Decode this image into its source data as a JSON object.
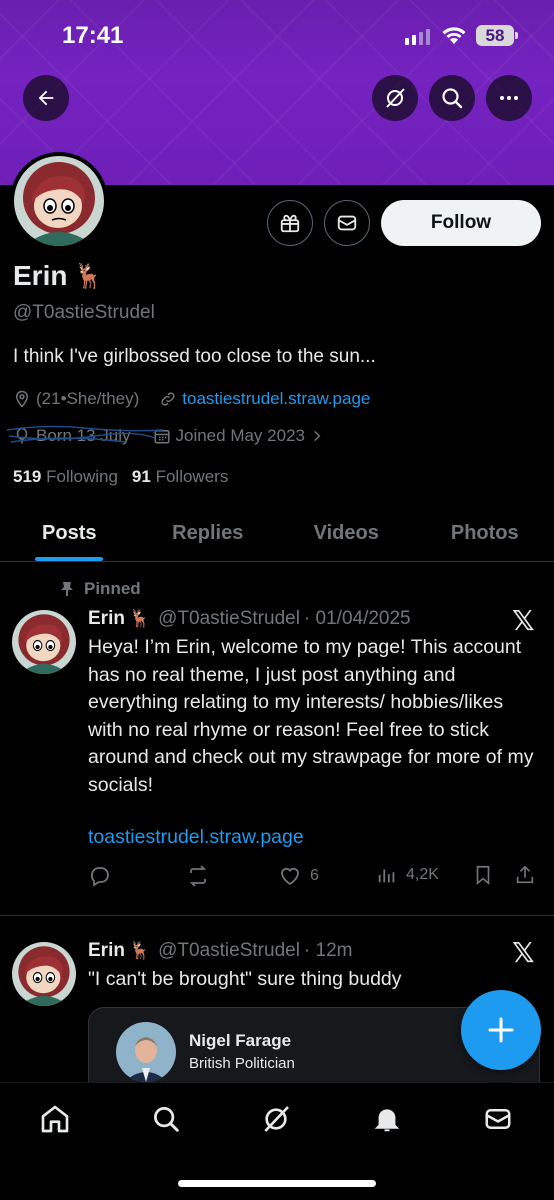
{
  "status_bar": {
    "time": "17:41",
    "battery": "58"
  },
  "profile": {
    "name": "Erin",
    "emoji": "🦌",
    "handle": "@T0astieStrudel",
    "follow_label": "Follow",
    "bio": "I think I've girlbossed too close to the sun...",
    "location": "(21•She/they)",
    "website": "toastiestrudel.straw.page",
    "born": "Born 13 July",
    "joined": "Joined May 2023",
    "following_count": "519",
    "following_label": "Following",
    "followers_count": "91",
    "followers_label": "Followers"
  },
  "tabs": [
    "Posts",
    "Replies",
    "Videos",
    "Photos"
  ],
  "posts": [
    {
      "pinned_label": "Pinned",
      "name": "Erin",
      "emoji": "🦌",
      "handle": "@T0astieStrudel",
      "date": "· 01/04/2025",
      "text": "Heya! I’m Erin, welcome to my page! This account has no real theme, I just post anything and everything relating to my interests/ hobbies/likes with no real rhyme or reason! Feel free to stick around and check out my strawpage for more of my socials!",
      "link": "toastiestrudel.straw.page",
      "likes": "6",
      "views": "4,2K"
    },
    {
      "name": "Erin",
      "emoji": "🦌",
      "handle": "@T0astieStrudel",
      "date": "· 12m",
      "text": "\"I can't be brought\" sure thing buddy",
      "quote": {
        "name": "Nigel Farage",
        "subtitle": "British Politician"
      }
    }
  ],
  "colors": {
    "accent": "#1d9bf0",
    "banner": "#6f1fb8",
    "muted": "#71767b"
  }
}
